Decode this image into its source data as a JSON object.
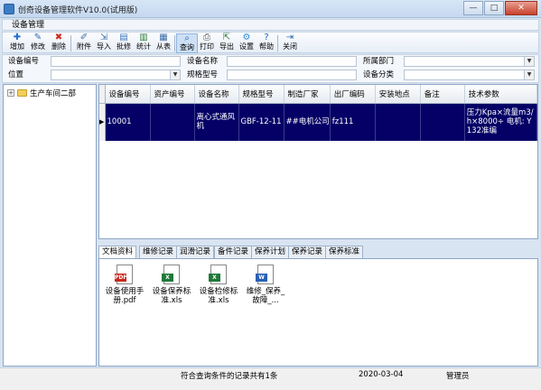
{
  "window": {
    "title": "创奇设备管理软件V10.0(试用版)",
    "minimize": "—",
    "maximize": "□",
    "close": "✕"
  },
  "menu": {
    "item": "设备管理"
  },
  "toolbar": [
    {
      "label": "增加",
      "icon": "plus-icon",
      "glyph": "✚",
      "color": "#1f6fd1"
    },
    {
      "label": "修改",
      "icon": "edit-icon",
      "glyph": "✎",
      "color": "#2f6fb5"
    },
    {
      "label": "删除",
      "icon": "delete-icon",
      "glyph": "✖",
      "color": "#d0281b"
    },
    {
      "label": "附件",
      "icon": "attach-icon",
      "glyph": "✐",
      "color": "#4a6fa0"
    },
    {
      "label": "导入",
      "icon": "import-icon",
      "glyph": "⇲",
      "color": "#3b6ea8"
    },
    {
      "label": "批修",
      "icon": "batch-edit-icon",
      "glyph": "▤",
      "color": "#3c78bd"
    },
    {
      "label": "统计",
      "icon": "stats-icon",
      "glyph": "▥",
      "color": "#2f7f3b"
    },
    {
      "label": "从表",
      "icon": "subtable-icon",
      "glyph": "▦",
      "color": "#3b6ea8"
    },
    {
      "label": "查询",
      "icon": "search-icon",
      "glyph": "⌕",
      "color": "#1f5aa8"
    },
    {
      "label": "打印",
      "icon": "print-icon",
      "glyph": "⎙",
      "color": "#555555"
    },
    {
      "label": "导出",
      "icon": "export-icon",
      "glyph": "⇱",
      "color": "#2f7f3b"
    },
    {
      "label": "设置",
      "icon": "settings-icon",
      "glyph": "⚙",
      "color": "#2a8bd8"
    },
    {
      "label": "帮助",
      "icon": "help-icon",
      "glyph": "?",
      "color": "#1d62c4"
    },
    {
      "label": "关闭",
      "icon": "exit-icon",
      "glyph": "⇥",
      "color": "#2f6fb5"
    }
  ],
  "filters": {
    "device_code": {
      "label": "设备编号",
      "value": ""
    },
    "device_name": {
      "label": "设备名称",
      "value": ""
    },
    "department": {
      "label": "所属部门",
      "value": ""
    },
    "location": {
      "label": "位置",
      "value": ""
    },
    "model": {
      "label": "规格型号",
      "value": ""
    },
    "category": {
      "label": "设备分类",
      "value": ""
    }
  },
  "tree": {
    "root": "生产车间二部",
    "expander": "+"
  },
  "grid": {
    "columns": [
      "设备编号",
      "资产编号",
      "设备名称",
      "规格型号",
      "制造厂家",
      "出厂编码",
      "安装地点",
      "备注",
      "技术参数"
    ],
    "rows": [
      [
        "10001",
        "",
        "离心式通风机",
        "GBF-12-11",
        "##电机公司",
        "fz111",
        "",
        "",
        "压力Kpa×流量m3/h×8000÷ 电机: Y132准编"
      ]
    ]
  },
  "tabs": [
    "文档资料",
    "维修记录",
    "润滑记录",
    "备件记录",
    "保养计划",
    "保养记录",
    "保养标准"
  ],
  "documents": [
    {
      "name": "设备使用手册.pdf",
      "type": "PDF",
      "color": "#c8281e"
    },
    {
      "name": "设备保养标准.xls",
      "type": "X",
      "color": "#1f7a3a"
    },
    {
      "name": "设备检修标准.xls",
      "type": "X",
      "color": "#1f7a3a"
    },
    {
      "name": "维修_保养_故障_...",
      "type": "W",
      "color": "#2a5fb5"
    }
  ],
  "status": {
    "record_count": "符合查询条件的记录共有1条",
    "date": "2020-03-04",
    "user": "管理员"
  }
}
